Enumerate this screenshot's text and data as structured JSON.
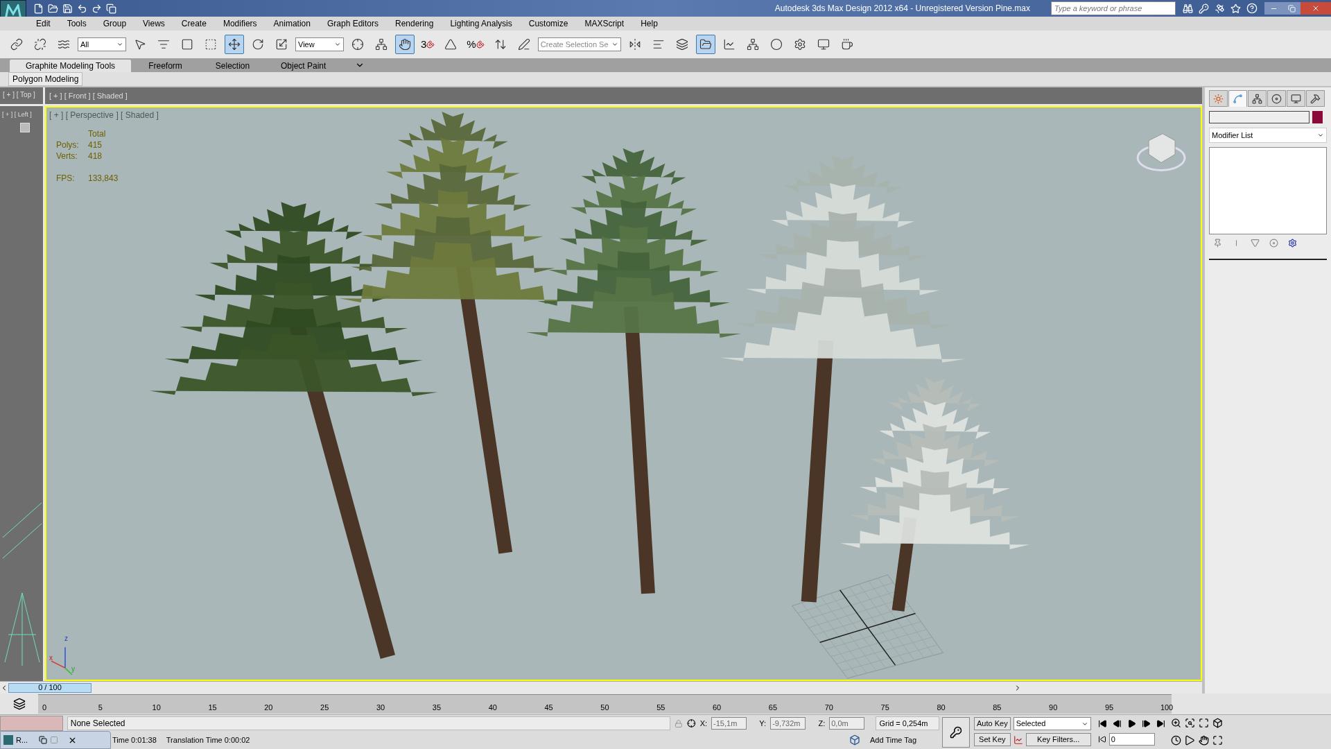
{
  "title_bar": {
    "title": "Autodesk 3ds Max Design 2012 x64 - Unregistered Version   Pine.max",
    "search": {
      "placeholder": "Type a keyword or phrase"
    }
  },
  "menu": [
    "Edit",
    "Tools",
    "Group",
    "Views",
    "Create",
    "Modifiers",
    "Animation",
    "Graph Editors",
    "Rendering",
    "Lighting Analysis",
    "Customize",
    "MAXScript",
    "Help"
  ],
  "toolbar": [
    {
      "kind": "icon",
      "selected": false
    },
    {
      "kind": "icon",
      "selected": false
    },
    {
      "kind": "icon",
      "selected": false
    },
    {
      "kind": "dropdown",
      "value": "All"
    },
    {
      "kind": "icon",
      "selected": false
    },
    {
      "kind": "icon",
      "selected": false
    },
    {
      "kind": "icon",
      "selected": false
    },
    {
      "kind": "icon",
      "selected": false
    },
    {
      "kind": "icon",
      "selected": true
    },
    {
      "kind": "icon",
      "selected": false
    },
    {
      "kind": "icon",
      "selected": false
    },
    {
      "kind": "dropdown",
      "value": "View"
    },
    {
      "kind": "icon",
      "selected": false
    },
    {
      "kind": "icon",
      "selected": false
    },
    {
      "kind": "icon",
      "selected": true
    },
    {
      "kind": "snap",
      "value": "3"
    },
    {
      "kind": "icon",
      "selected": false
    },
    {
      "kind": "snap",
      "value": "%"
    },
    {
      "kind": "icon",
      "selected": false
    },
    {
      "kind": "icon",
      "selected": false
    },
    {
      "kind": "dropdown",
      "placeholder": "Create Selection Se"
    },
    {
      "kind": "icon",
      "selected": false
    },
    {
      "kind": "icon",
      "selected": false
    },
    {
      "kind": "icon",
      "selected": false
    },
    {
      "kind": "icon",
      "selected": true
    },
    {
      "kind": "icon",
      "selected": false
    },
    {
      "kind": "icon",
      "selected": false
    },
    {
      "kind": "icon",
      "selected": false
    },
    {
      "kind": "icon",
      "selected": false
    },
    {
      "kind": "icon",
      "selected": false
    },
    {
      "kind": "icon",
      "selected": false
    }
  ],
  "ribbon": {
    "tabs": [
      {
        "label": "Graphite Modeling Tools",
        "selected": true
      },
      {
        "label": "Freeform",
        "selected": false
      },
      {
        "label": "Selection",
        "selected": false
      },
      {
        "label": "Object Paint",
        "selected": false
      }
    ],
    "panel": "Polygon Modeling"
  },
  "viewports": {
    "top": {
      "label": "[ + ] [ Top ]",
      "active": false
    },
    "front": {
      "label": "[ + ] [ Front ] [ Shaded ]",
      "active": false
    },
    "left": {
      "label": "[ + ] [ Left ]",
      "active": false
    },
    "perspective": {
      "label": "[ + ] [ Perspective ] [ Shaded ]",
      "active": true,
      "stats_header": "Total",
      "stats": [
        {
          "label": "Polys:",
          "value": "415"
        },
        {
          "label": "Verts:",
          "value": "418"
        },
        {
          "label": "FPS:",
          "value": "133,843"
        }
      ],
      "axis_labels": [
        "z",
        "x",
        "y"
      ]
    }
  },
  "command_panel": {
    "tabs": [
      {
        "selected": false
      },
      {
        "selected": true
      },
      {
        "selected": false
      },
      {
        "selected": false
      },
      {
        "selected": false
      },
      {
        "selected": false
      }
    ],
    "modifier_list": "Modifier List"
  },
  "time_slider": {
    "reading": "0 / 100",
    "level": 0
  },
  "track_bar": {
    "ticks": [
      "0",
      "5",
      "10",
      "15",
      "20",
      "25",
      "30",
      "35",
      "40",
      "45",
      "50",
      "55",
      "60",
      "65",
      "70",
      "75",
      "80",
      "85",
      "90",
      "95",
      "100"
    ]
  },
  "status": {
    "selection": "None Selected",
    "x_label": "X:",
    "x": "-15,1m",
    "y_label": "Y:",
    "y": "-9,732m",
    "z_label": "Z:",
    "z": "0,0m",
    "grid": "Grid = 0,254m",
    "prompt": "Time  0:01:38",
    "translation": "Translation Time  0:00:02",
    "add_time_tag": "Add Time Tag"
  },
  "animation": {
    "auto_key": "Auto Key",
    "set_key": "Set Key",
    "key_mode": "Selected",
    "key_filters": "Key Filters...",
    "frame": "0"
  },
  "minimized_window": {
    "title": "R..."
  }
}
